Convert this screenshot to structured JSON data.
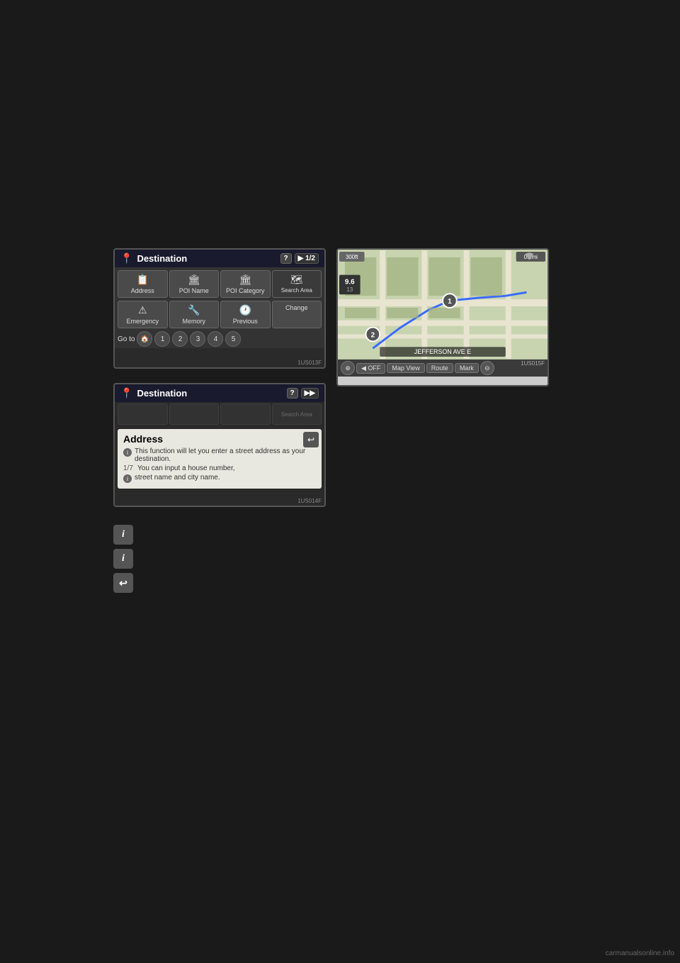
{
  "page": {
    "background": "#1a1a1a",
    "watermark": "carmanualsonline.info"
  },
  "dest_screen_1": {
    "title": "Destination",
    "page_indicator": "▶ 1/2",
    "screen_id": "1US013F",
    "buttons": [
      {
        "label": "Address",
        "icon": "📋"
      },
      {
        "label": "POI Name",
        "icon": "🏛"
      },
      {
        "label": "POI Category",
        "icon": "🏛"
      },
      {
        "label": "Search Area",
        "icon": "🗺"
      }
    ],
    "row2_buttons": [
      {
        "label": "Emergency",
        "icon": "⚠"
      },
      {
        "label": "Memory",
        "icon": "🔧"
      },
      {
        "label": "Previous",
        "icon": "🕐"
      },
      {
        "label": "Change",
        "icon": ""
      }
    ],
    "goto_label": "Go to",
    "goto_icon": "🏠",
    "number_buttons": [
      "1",
      "2",
      "3",
      "4",
      "5"
    ]
  },
  "dest_screen_2": {
    "title": "Destination",
    "screen_id": "1US014F",
    "address_panel": {
      "title": "Address",
      "info_lines": [
        {
          "number": "1/7",
          "text": "This function will let you enter a street address as your destination."
        },
        {
          "text": "You can input a house number,"
        },
        {
          "text": "street name and city name."
        }
      ]
    }
  },
  "map_screen": {
    "screen_id": "1US015F",
    "distance_top_left": "300ft",
    "distance_top_right": "0.2mi",
    "speed_label": "9.6",
    "speed_sub": "13",
    "street_label": "JEFFERSON AVE E",
    "waypoint_labels": [
      "1",
      "2"
    ],
    "controls": [
      {
        "label": "⊕",
        "type": "round"
      },
      {
        "label": "◀ OFF",
        "type": "text"
      },
      {
        "label": "Map View",
        "type": "text"
      },
      {
        "label": "Route",
        "type": "text"
      },
      {
        "label": "Mark",
        "type": "text"
      },
      {
        "label": "⊖",
        "type": "round"
      }
    ]
  },
  "legend": {
    "items": [
      {
        "icon": "i",
        "description": "Info icon 1"
      },
      {
        "icon": "i",
        "description": "Info icon 2"
      },
      {
        "icon": "↩",
        "description": "Back icon"
      }
    ]
  }
}
